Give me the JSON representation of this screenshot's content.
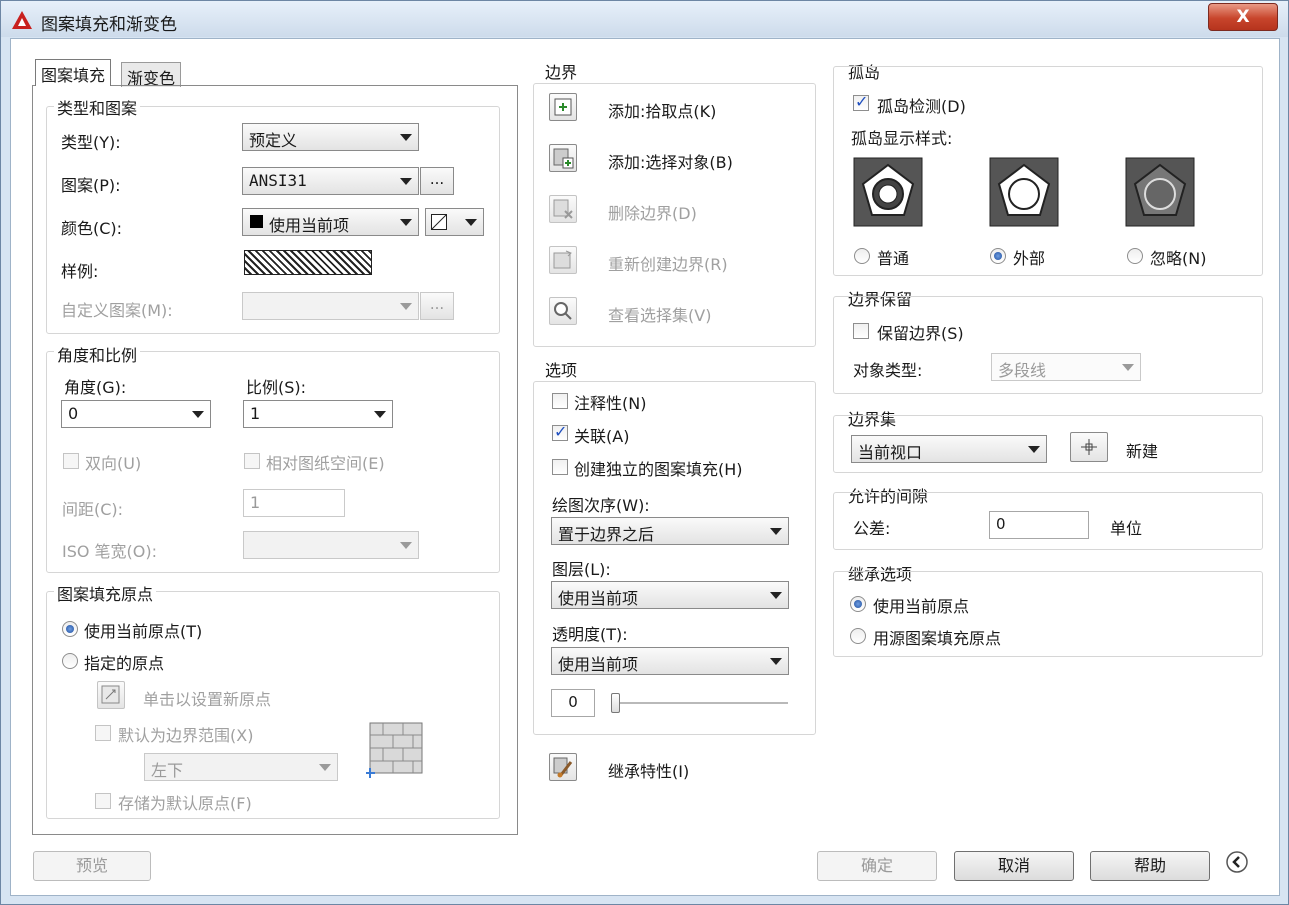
{
  "window": {
    "title": "图案填充和渐变色",
    "close": "X"
  },
  "tabs": [
    "图案填充",
    "渐变色"
  ],
  "type_pattern": {
    "title": "类型和图案",
    "type_label": "类型(Y):",
    "type_value": "预定义",
    "pattern_label": "图案(P):",
    "pattern_value": "ANSI31",
    "color_label": "颜色(C):",
    "color_value": "使用当前项",
    "sample_label": "样例:",
    "custom_label": "自定义图案(M):",
    "ellipsis": "..."
  },
  "angle_scale": {
    "title": "角度和比例",
    "angle_label": "角度(G):",
    "angle_value": "0",
    "scale_label": "比例(S):",
    "scale_value": "1",
    "double_label": "双向(U)",
    "relative_label": "相对图纸空间(E)",
    "spacing_label": "间距(C):",
    "spacing_value": "1",
    "iso_label": "ISO 笔宽(O):"
  },
  "origin": {
    "title": "图案填充原点",
    "use_current": "使用当前原点(T)",
    "specified": "指定的原点",
    "click_set": "单击以设置新原点",
    "default_extent": "默认为边界范围(X)",
    "extent_value": "左下",
    "store_default": "存储为默认原点(F)"
  },
  "boundary": {
    "title": "边界",
    "add_pick": "添加:拾取点(K)",
    "add_select": "添加:选择对象(B)",
    "remove": "删除边界(D)",
    "recreate": "重新创建边界(R)",
    "view_set": "查看选择集(V)"
  },
  "options": {
    "title": "选项",
    "annotative": "注释性(N)",
    "associative": "关联(A)",
    "separate": "创建独立的图案填充(H)",
    "draw_order_label": "绘图次序(W):",
    "draw_order_value": "置于边界之后",
    "layer_label": "图层(L):",
    "layer_value": "使用当前项",
    "transparency_label": "透明度(T):",
    "transparency_value": "使用当前项",
    "transparency_num": "0"
  },
  "inherit": {
    "label": "继承特性(I)"
  },
  "islands": {
    "title": "孤岛",
    "detect": "孤岛检测(D)",
    "style_label": "孤岛显示样式:",
    "normal": "普通",
    "outer": "外部",
    "ignore": "忽略(N)"
  },
  "retain": {
    "title": "边界保留",
    "retain_label": "保留边界(S)",
    "object_type_label": "对象类型:",
    "object_type_value": "多段线"
  },
  "boundary_set": {
    "title": "边界集",
    "value": "当前视口",
    "new_label": "新建"
  },
  "gap": {
    "title": "允许的间隙",
    "tolerance_label": "公差:",
    "tolerance_value": "0",
    "unit": "单位"
  },
  "inherit_opts": {
    "title": "继承选项",
    "use_current": "使用当前原点",
    "use_source": "用源图案填充原点"
  },
  "footer": {
    "preview": "预览",
    "ok": "确定",
    "cancel": "取消",
    "help": "帮助"
  }
}
